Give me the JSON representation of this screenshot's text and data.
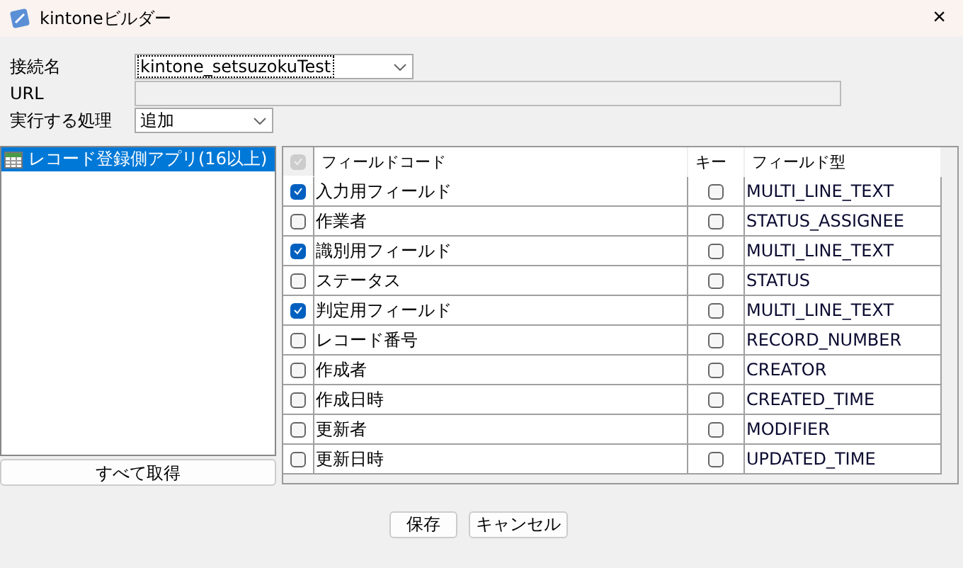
{
  "window": {
    "title": "kintoneビルダー",
    "close": "×"
  },
  "form": {
    "connection": {
      "label": "接続名",
      "value": "kintone_setsuzokuTest"
    },
    "url": {
      "label": "URL"
    },
    "action": {
      "label": "実行する処理",
      "value": "追加"
    }
  },
  "apps": {
    "items": [
      {
        "label": "レコード登録側アプリ(16以上)",
        "selected": true
      }
    ],
    "fetch_button": "すべて取得"
  },
  "table": {
    "header_checkbox": {
      "checked": true,
      "disabled": true
    },
    "columns": [
      "フィールドコード",
      "キー",
      "フィールド型"
    ],
    "rows": [
      {
        "checked": true,
        "code": "入力用フィールド",
        "key": false,
        "type": "MULTI_LINE_TEXT"
      },
      {
        "checked": false,
        "code": "作業者",
        "key": false,
        "type": "STATUS_ASSIGNEE"
      },
      {
        "checked": true,
        "code": "識別用フィールド",
        "key": false,
        "type": "MULTI_LINE_TEXT"
      },
      {
        "checked": false,
        "code": "ステータス",
        "key": false,
        "type": "STATUS"
      },
      {
        "checked": true,
        "code": "判定用フィールド",
        "key": false,
        "type": "MULTI_LINE_TEXT"
      },
      {
        "checked": false,
        "code": "レコード番号",
        "key": false,
        "type": "RECORD_NUMBER"
      },
      {
        "checked": false,
        "code": "作成者",
        "key": false,
        "type": "CREATOR"
      },
      {
        "checked": false,
        "code": "作成日時",
        "key": false,
        "type": "CREATED_TIME"
      },
      {
        "checked": false,
        "code": "更新者",
        "key": false,
        "type": "MODIFIER"
      },
      {
        "checked": false,
        "code": "更新日時",
        "key": false,
        "type": "UPDATED_TIME"
      }
    ]
  },
  "buttons": [
    "保存",
    "キャンセル"
  ]
}
